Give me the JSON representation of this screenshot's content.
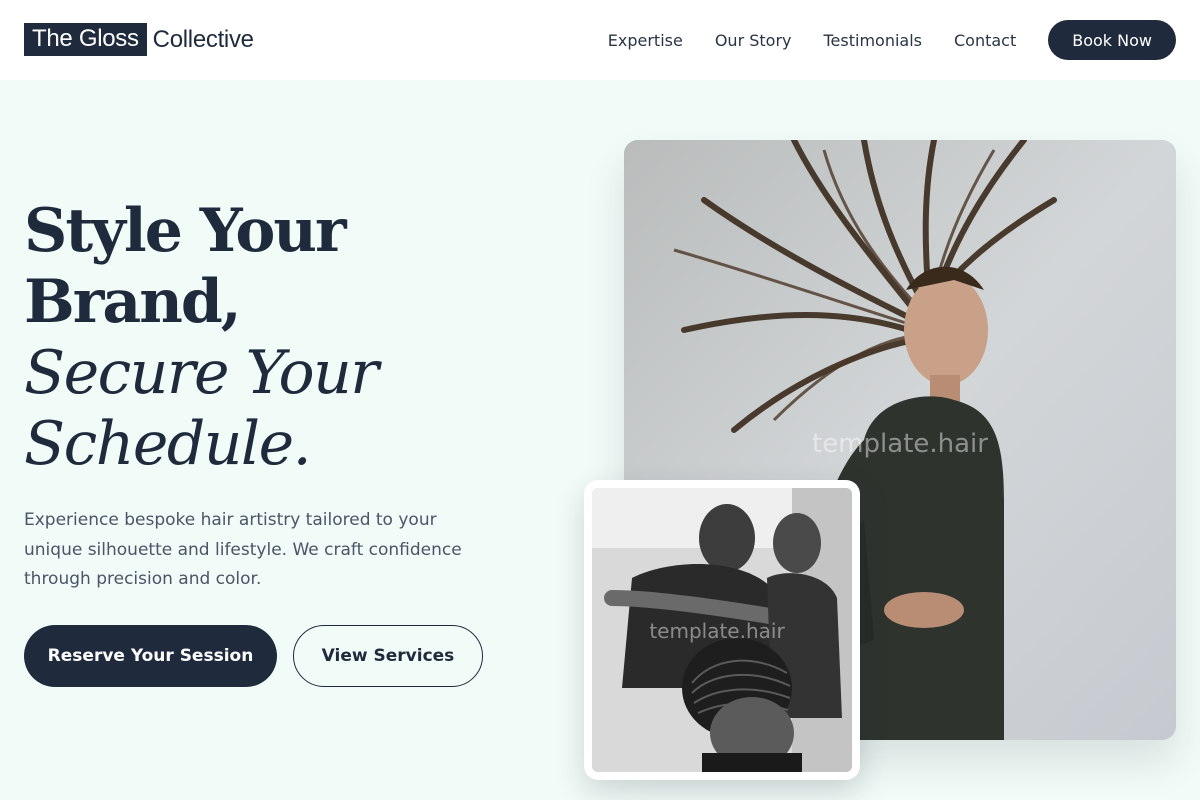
{
  "header": {
    "logo_highlight": "The Gloss",
    "logo_rest": "Collective",
    "nav": [
      "Expertise",
      "Our Story",
      "Testimonials",
      "Contact"
    ],
    "cta": "Book Now"
  },
  "hero": {
    "headline_line1": "Style Your",
    "headline_line2": "Brand,",
    "headline_line3": "Secure Your",
    "headline_line4": "Schedule.",
    "lead": "Experience bespoke hair artistry tailored to your unique silhouette and lifestyle. We craft confidence through precision and color.",
    "primary_button": "Reserve Your Session",
    "secondary_button": "View Services",
    "watermark": "template.hair"
  },
  "colors": {
    "navy": "#1f2a3d",
    "background": "#f1fbf7",
    "text_muted": "#4a5568"
  }
}
